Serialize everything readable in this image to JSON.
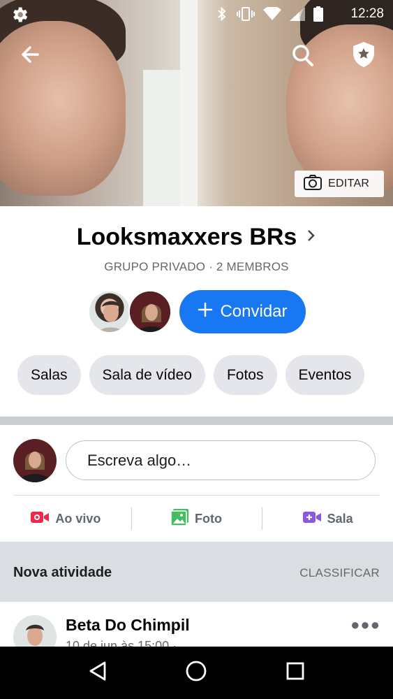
{
  "status_bar": {
    "time": "12:28",
    "icons": [
      "settings-gear-icon",
      "bluetooth-icon",
      "vibrate-icon",
      "wifi-icon",
      "cell-signal-icon",
      "battery-icon"
    ]
  },
  "cover": {
    "back_icon": "arrow-left-icon",
    "search_icon": "search-icon",
    "admin_icon": "shield-star-icon",
    "edit_label": "EDITAR"
  },
  "group": {
    "name": "Looksmaxxers BRs",
    "subtitle": "GRUPO PRIVADO · 2 MEMBROS",
    "invite_label": "Convidar"
  },
  "tabs": [
    {
      "label": "Salas"
    },
    {
      "label": "Sala de vídeo"
    },
    {
      "label": "Fotos"
    },
    {
      "label": "Eventos"
    }
  ],
  "composer": {
    "placeholder": "Escreva algo…",
    "actions": [
      {
        "label": "Ao vivo",
        "icon": "live-video-icon",
        "color": "#f02849"
      },
      {
        "label": "Foto",
        "icon": "photo-icon",
        "color": "#45bd62"
      },
      {
        "label": "Sala",
        "icon": "room-video-icon",
        "color": "#8c57e0"
      }
    ]
  },
  "activity": {
    "title": "Nova atividade",
    "sort_label": "CLASSIFICAR"
  },
  "post": {
    "author": "Beta Do Chimpil",
    "date": "10 de jun às 15:00 ·"
  },
  "colors": {
    "accent": "#1877f2",
    "pill_bg": "#e4e6eb",
    "section_bg": "#dadde1"
  }
}
